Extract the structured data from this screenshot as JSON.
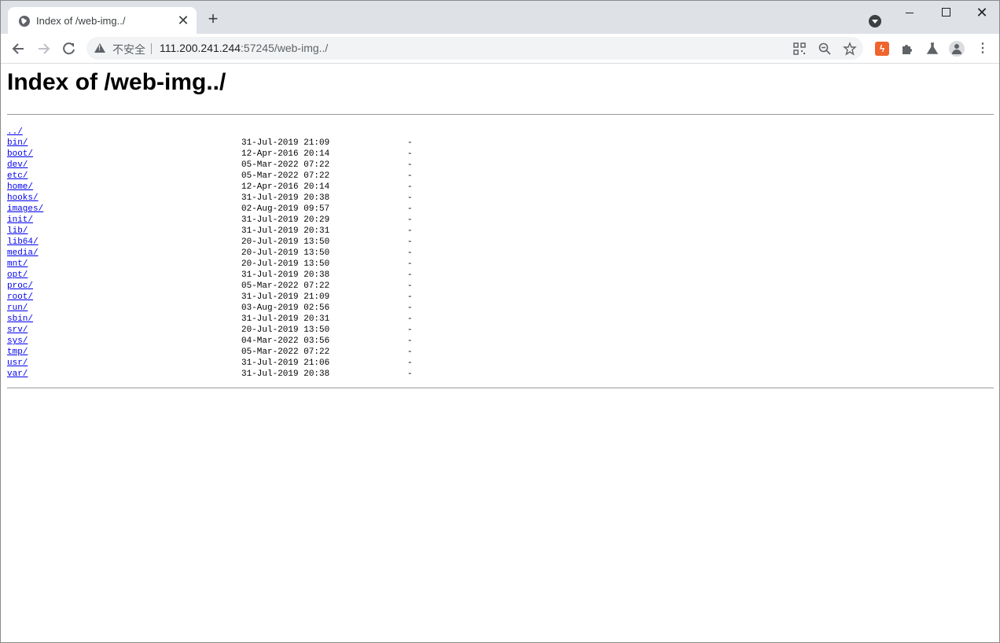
{
  "browser": {
    "tab_title": "Index of /web-img../",
    "tab_close": "✕",
    "new_tab": "+",
    "insecure_label": "不安全",
    "url_host": "111.200.241.244",
    "url_rest": ":57245/web-img../",
    "icons": [
      "back-icon",
      "forward-icon",
      "reload-icon",
      "warning-icon",
      "qr-code-icon",
      "zoom-out-icon",
      "star-icon",
      "extension-icon",
      "puzzle-icon",
      "labs-icon",
      "profile-icon",
      "menu-icon"
    ]
  },
  "page": {
    "heading": "Index of /web-img../",
    "parent": "../",
    "entries": [
      {
        "name": "bin/",
        "date": "31-Jul-2019 21:09",
        "size": "-"
      },
      {
        "name": "boot/",
        "date": "12-Apr-2016 20:14",
        "size": "-"
      },
      {
        "name": "dev/",
        "date": "05-Mar-2022 07:22",
        "size": "-"
      },
      {
        "name": "etc/",
        "date": "05-Mar-2022 07:22",
        "size": "-"
      },
      {
        "name": "home/",
        "date": "12-Apr-2016 20:14",
        "size": "-"
      },
      {
        "name": "hooks/",
        "date": "31-Jul-2019 20:38",
        "size": "-"
      },
      {
        "name": "images/",
        "date": "02-Aug-2019 09:57",
        "size": "-"
      },
      {
        "name": "init/",
        "date": "31-Jul-2019 20:29",
        "size": "-"
      },
      {
        "name": "lib/",
        "date": "31-Jul-2019 20:31",
        "size": "-"
      },
      {
        "name": "lib64/",
        "date": "20-Jul-2019 13:50",
        "size": "-"
      },
      {
        "name": "media/",
        "date": "20-Jul-2019 13:50",
        "size": "-"
      },
      {
        "name": "mnt/",
        "date": "20-Jul-2019 13:50",
        "size": "-"
      },
      {
        "name": "opt/",
        "date": "31-Jul-2019 20:38",
        "size": "-"
      },
      {
        "name": "proc/",
        "date": "05-Mar-2022 07:22",
        "size": "-"
      },
      {
        "name": "root/",
        "date": "31-Jul-2019 21:09",
        "size": "-"
      },
      {
        "name": "run/",
        "date": "03-Aug-2019 02:56",
        "size": "-"
      },
      {
        "name": "sbin/",
        "date": "31-Jul-2019 20:31",
        "size": "-"
      },
      {
        "name": "srv/",
        "date": "20-Jul-2019 13:50",
        "size": "-"
      },
      {
        "name": "sys/",
        "date": "04-Mar-2022 03:56",
        "size": "-"
      },
      {
        "name": "tmp/",
        "date": "05-Mar-2022 07:22",
        "size": "-"
      },
      {
        "name": "usr/",
        "date": "31-Jul-2019 21:06",
        "size": "-"
      },
      {
        "name": "var/",
        "date": "31-Jul-2019 20:38",
        "size": "-"
      }
    ]
  }
}
